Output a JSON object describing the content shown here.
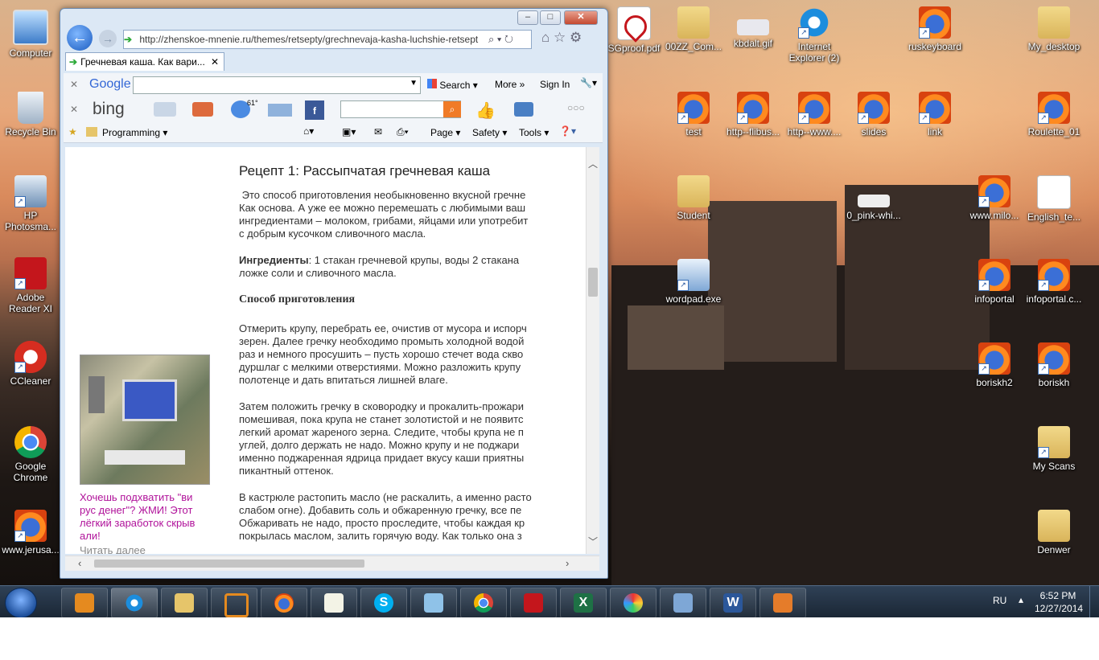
{
  "desktop": {
    "left_icons": [
      {
        "label": "Computer"
      },
      {
        "label": "Recycle Bin"
      },
      {
        "label": "HP Photosma..."
      },
      {
        "label": "Adobe Reader XI"
      },
      {
        "label": "CCleaner"
      },
      {
        "label": "Google Chrome"
      },
      {
        "label": "www.jerusa..."
      }
    ],
    "right_icons": [
      {
        "label": "SGproof.pdf"
      },
      {
        "label": "00ZZ_Com..."
      },
      {
        "label": "kbdalt.gif"
      },
      {
        "label": "Internet Explorer (2)"
      },
      {
        "label": "ruskeyboard"
      },
      {
        "label": "My_desktop"
      },
      {
        "label": "test"
      },
      {
        "label": "http--flibus..."
      },
      {
        "label": "http--www...."
      },
      {
        "label": "slides"
      },
      {
        "label": "link"
      },
      {
        "label": "Roulette_01"
      },
      {
        "label": "Student"
      },
      {
        "label": "0_pink-whi..."
      },
      {
        "label": "www.milo..."
      },
      {
        "label": "English_te..."
      },
      {
        "label": "wordpad.exe"
      },
      {
        "label": "infoportal"
      },
      {
        "label": "infoportal.c..."
      },
      {
        "label": "boriskh2"
      },
      {
        "label": "boriskh"
      },
      {
        "label": "My Scans"
      },
      {
        "label": "Denwer"
      }
    ]
  },
  "browser": {
    "address": "http://zhenskoe-mnenie.ru/themes/retsepty/grechnevaja-kasha-luchshie-retsept",
    "tab_title": "Гречневая каша. Как вари...",
    "google_toolbar": {
      "brand": "Google",
      "search_label": "Search",
      "more_label": "More",
      "signin_label": "Sign In"
    },
    "bing_toolbar": {
      "brand": "bing",
      "badge": "61°"
    },
    "fav_bar": {
      "folder": "Programming",
      "page_menu": "Page",
      "safety_menu": "Safety",
      "tools_menu": "Tools"
    },
    "article": {
      "heading": "Рецепт 1: Рассыпчатая гречневая каша",
      "p1": [
        " Это способ приготовления необыкновенно вкусной гречне",
        "Как основа. А уже ее можно перемешать с любимыми ваш",
        "ингредиентами – молоком, грибами, яйцами или употребит",
        "с добрым кусочком сливочного масла."
      ],
      "ingredients_label": "Ингредиенты",
      "ingredients_text": [
        ": 1 стакан гречневой крупы, воды 2 стакана",
        "ложке соли и сливочного масла."
      ],
      "method_label": "Способ приготовления",
      "p2": [
        "Отмерить крупу, перебрать ее, очистив от мусора и испорч",
        "зерен. Далее гречку необходимо промыть холодной водой",
        "раз и немного просушить – пусть хорошо стечет вода скво",
        "дуршлаг с мелкими отверстиями. Можно разложить крупу",
        "полотенце и дать впитаться лишней влаге."
      ],
      "p3": [
        "Затем положить гречку в сковородку и прокалить-прожари",
        "помешивая, пока крупа не станет золотистой и не появитс",
        "легкий аромат жареного зерна. Следите, чтобы крупа не п",
        "углей, долго держать не надо. Можно крупу и не поджари",
        "именно поджаренная ядрица придает вкусу каши приятны",
        "пикантный оттенок."
      ],
      "p4": [
        "В кастрюле растопить масло (не раскалить, а именно расто",
        "слабом огне). Добавить соль и обжаренную гречку, все пе",
        "Обжаривать не надо, просто проследите, чтобы каждая кр",
        "покрылась маслом, залить горячую воду. Как только она з"
      ]
    },
    "ad": {
      "text": [
        "Хочешь подхватить \"ви",
        "рус денег\"? ЖМИ! Этот",
        "лёгкий заработок скрыв",
        "али!"
      ],
      "more": "Читать далее"
    }
  },
  "taskbar": {
    "language": "RU",
    "time": "6:52 PM",
    "date": "12/27/2014"
  }
}
